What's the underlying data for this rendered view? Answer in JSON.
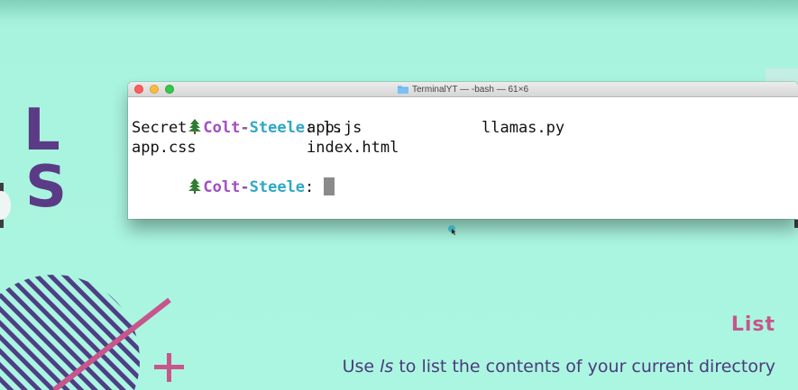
{
  "slide": {
    "big_letters": [
      "L",
      "S"
    ],
    "heading": "List",
    "caption": {
      "before": "Use ",
      "command": "ls",
      "after": " to list the contents of your current directory"
    },
    "colors": {
      "background": "#abf6e0",
      "letters": "#5b3b86",
      "heading": "#c8558c",
      "caption": "#4b3a7c",
      "stripes": "#4d3f86",
      "slash": "#c8558c"
    }
  },
  "terminal": {
    "window_title": "TerminalYT — -bash — 61×6",
    "prompt": {
      "icon": "tree-icon",
      "user_first": "Colt",
      "dash": "-",
      "user_last": "Steele",
      "separator": ": "
    },
    "command": "ls",
    "output": [
      [
        "Secret",
        "app.js",
        "llamas.py"
      ],
      [
        "app.css",
        "index.html",
        ""
      ]
    ]
  }
}
